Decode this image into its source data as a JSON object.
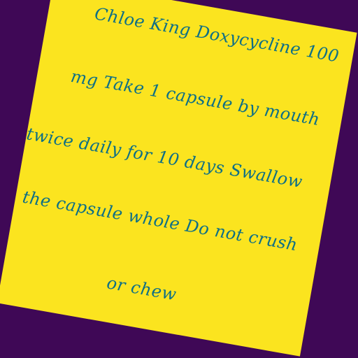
{
  "label": {
    "lines": [
      "Chloe King Doxycycline 100",
      "mg Take 1 capsule by mouth",
      "twice daily for 10 days Swallow",
      "the capsule whole Do not crush",
      "or chew"
    ]
  },
  "colors": {
    "background": "#3f0856",
    "paper": "#fbe41f",
    "text": "#0e6f86"
  }
}
